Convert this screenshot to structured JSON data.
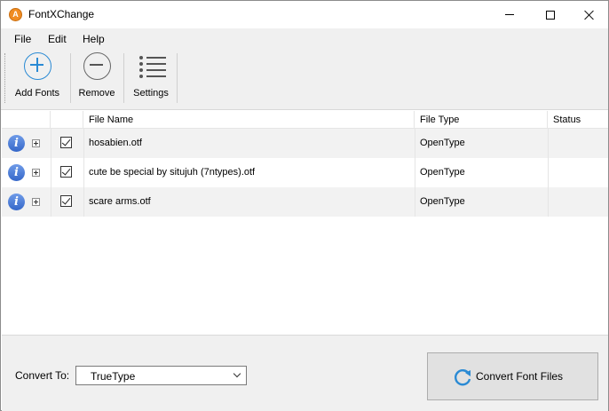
{
  "window": {
    "title": "FontXChange",
    "app_icon_letter": "A",
    "controls": [
      "minimize",
      "maximize",
      "close"
    ]
  },
  "menu": {
    "items": [
      {
        "label": "File"
      },
      {
        "label": "Edit"
      },
      {
        "label": "Help"
      }
    ]
  },
  "toolbar": {
    "buttons": [
      {
        "label": "Add Fonts",
        "icon": "plus-circle-icon",
        "color": "#2a8ad4"
      },
      {
        "label": "Remove",
        "icon": "minus-circle-icon"
      },
      {
        "label": "Settings",
        "icon": "list-settings-icon"
      }
    ]
  },
  "table": {
    "columns": [
      "",
      "",
      "File Name",
      "File Type",
      "Status"
    ],
    "rows": [
      {
        "checked": true,
        "file_name": "hosabien.otf",
        "file_type": "OpenType",
        "status": ""
      },
      {
        "checked": true,
        "file_name": "cute be special by situjuh (7ntypes).otf",
        "file_type": "OpenType",
        "status": ""
      },
      {
        "checked": true,
        "file_name": "scare arms.otf",
        "file_type": "OpenType",
        "status": ""
      }
    ]
  },
  "bottom": {
    "convert_to_label": "Convert To:",
    "convert_to_value": "TrueType",
    "convert_button_label": "Convert Font Files"
  },
  "colors": {
    "accent": "#2a8ad4",
    "info_icon": "#3567c9",
    "app_icon": "#f08c22"
  }
}
